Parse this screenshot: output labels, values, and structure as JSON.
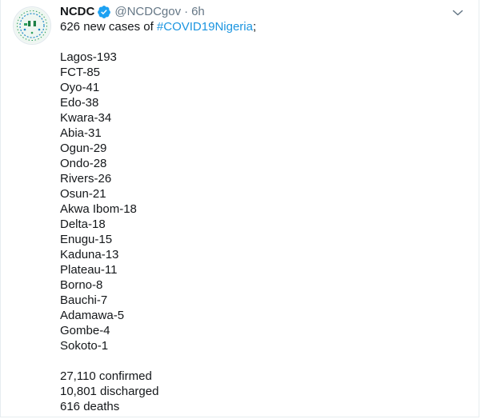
{
  "tweet": {
    "author": {
      "display_name": "NCDC",
      "handle": "@NCDCgov",
      "separator": "·",
      "time": "6h",
      "verified_icon": "verified-badge-icon",
      "avatar_icon": "ncdc-logo-icon"
    },
    "menu_icon": "chevron-down-icon",
    "intro": {
      "prefix": "626 new cases of ",
      "hashtag": "#COVID19Nigeria",
      "suffix": ";"
    },
    "states": [
      "Lagos-193",
      "FCT-85",
      "Oyo-41",
      "Edo-38",
      "Kwara-34",
      "Abia-31",
      "Ogun-29",
      "Ondo-28",
      "Rivers-26",
      "Osun-21",
      "Akwa Ibom-18",
      "Delta-18",
      "Enugu-15",
      "Kaduna-13",
      "Plateau-11",
      "Borno-8",
      "Bauchi-7",
      "Adamawa-5",
      "Gombe-4",
      "Sokoto-1"
    ],
    "totals": [
      "27,110 confirmed",
      "10,801 discharged",
      "616 deaths"
    ]
  },
  "colors": {
    "text": "#14171a",
    "secondary": "#657786",
    "link": "#1b95e0",
    "verified": "#1da1f2"
  }
}
